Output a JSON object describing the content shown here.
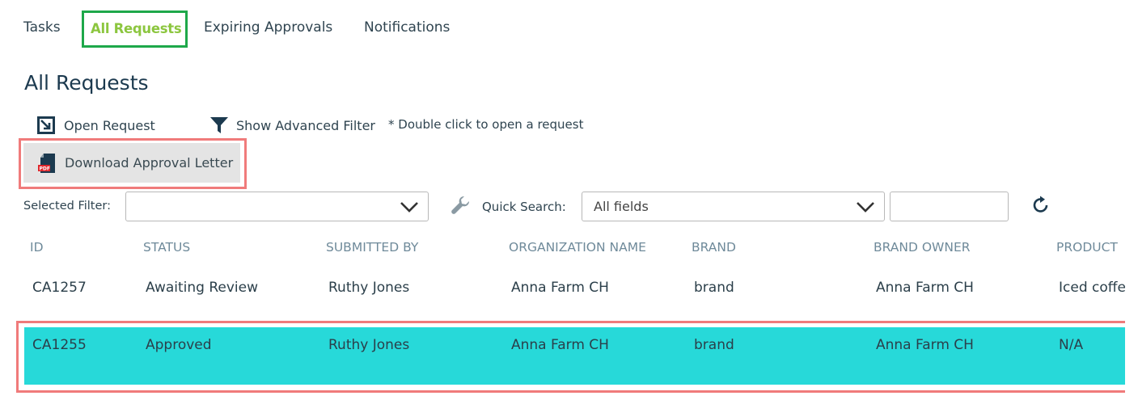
{
  "tabs": [
    {
      "label": "Tasks"
    },
    {
      "label": "All Requests"
    },
    {
      "label": "Expiring Approvals"
    },
    {
      "label": "Notifications"
    }
  ],
  "page_title": "All Requests",
  "toolbar": {
    "open_request": "Open Request",
    "show_filter": "Show Advanced Filter",
    "hint": "* Double click to open a request",
    "download_letter": "Download Approval Letter",
    "pdf_label": "PDF"
  },
  "filter": {
    "selected_filter_label": "Selected Filter:",
    "selected_filter_value": "",
    "quick_search_label": "Quick Search:",
    "quick_search_field": "All fields",
    "quick_search_text": ""
  },
  "table": {
    "columns": [
      "ID",
      "STATUS",
      "SUBMITTED BY",
      "ORGANIZATION NAME",
      "BRAND",
      "BRAND OWNER",
      "PRODUCT"
    ],
    "rows": [
      {
        "id": "CA1257",
        "status": "Awaiting Review",
        "submitted_by": "Ruthy Jones",
        "org": "Anna Farm CH",
        "brand": "brand",
        "brand_owner": "Anna Farm CH",
        "product": "Iced coffee"
      },
      {
        "id": "CA1255",
        "status": "Approved",
        "submitted_by": "Ruthy Jones",
        "org": "Anna Farm CH",
        "brand": "brand",
        "brand_owner": "Anna Farm CH",
        "product": "N/A"
      }
    ]
  },
  "colors": {
    "active_tab": "#8cc63f",
    "active_tab_border": "#1ea84a",
    "highlight_border": "#f07b7b",
    "selected_row": "#27d9d9"
  }
}
